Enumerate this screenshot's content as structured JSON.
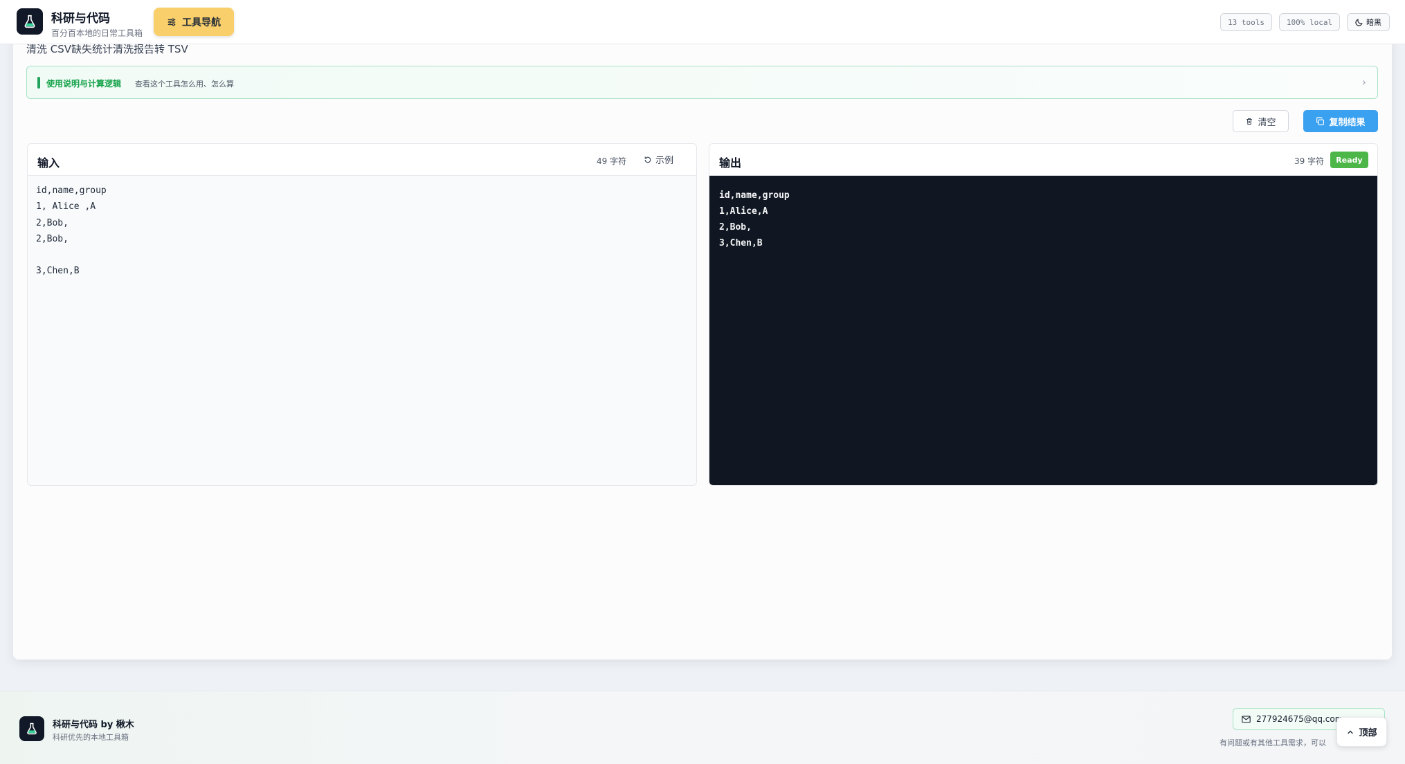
{
  "header": {
    "title": "科研与代码",
    "subtitle": "百分百本地的日常工具箱",
    "nav_label": "工具导航",
    "pill_tools": "13 tools",
    "pill_local": "100% local",
    "theme_label": "暗黑"
  },
  "page": {
    "description": "清洗 CSV缺失统计清洗报告转 TSV"
  },
  "usage": {
    "title": "使用说明与计算逻辑",
    "subtitle": "查看这个工具怎么用、怎么算"
  },
  "toolbar": {
    "clear_label": "清空",
    "copy_label": "复制结果"
  },
  "input_panel": {
    "title": "输入",
    "count": "49 字符",
    "example_label": "示例",
    "content": "id,name,group\n1, Alice ,A\n2,Bob,\n2,Bob,\n\n3,Chen,B"
  },
  "output_panel": {
    "title": "输出",
    "count": "39 字符",
    "status": "Ready",
    "content": "id,name,group\n1,Alice,A\n2,Bob,\n3,Chen,B"
  },
  "footer": {
    "title": "科研与代码 by 楸木",
    "subtitle": "科研优先的本地工具箱",
    "email": "277924675@qq.com",
    "note": "有问题或有其他工具需求，可以",
    "top_label": "顶部"
  },
  "colors": {
    "accent_green": "#22a35d",
    "nav_yellow": "#f9cf6b",
    "copy_blue": "#3aa0f0",
    "ready_green": "#4cb648",
    "output_bg": "#111722"
  }
}
